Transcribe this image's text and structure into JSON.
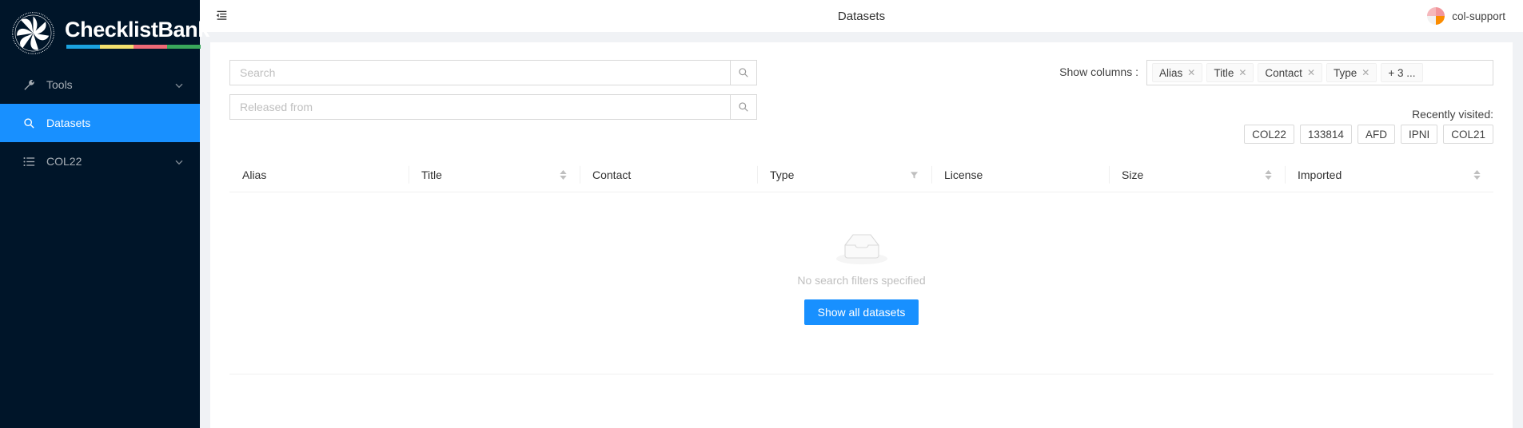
{
  "brand": {
    "title": "ChecklistBank",
    "logo_icon": "checklistbank-flower-logo",
    "bar_colors": [
      "#1ba3e0",
      "#f2e06e",
      "#ee6a76",
      "#39a85b"
    ]
  },
  "sidebar": {
    "background": "#001529",
    "active_color": "#1890ff",
    "items": [
      {
        "label": "Tools",
        "icon": "tool-icon",
        "active": false,
        "has_chevron": true
      },
      {
        "label": "Datasets",
        "icon": "search-icon",
        "active": true,
        "has_chevron": false
      },
      {
        "label": "COL22",
        "icon": "unordered-list-icon",
        "active": false,
        "has_chevron": true
      }
    ]
  },
  "topbar": {
    "fold_icon": "menu-fold-icon",
    "title": "Datasets",
    "user": {
      "name": "col-support",
      "avatar_icon": "user-avatar"
    }
  },
  "filters": {
    "search": {
      "placeholder": "Search",
      "value": "",
      "button_icon": "search-icon"
    },
    "released_from": {
      "placeholder": "Released from",
      "value": "",
      "button_icon": "search-icon"
    }
  },
  "show_columns": {
    "label": "Show columns :",
    "tags": [
      {
        "label": "Alias",
        "closable": true
      },
      {
        "label": "Title",
        "closable": true
      },
      {
        "label": "Contact",
        "closable": true
      },
      {
        "label": "Type",
        "closable": true
      },
      {
        "label": "+ 3 ...",
        "closable": false
      }
    ]
  },
  "recently_visited": {
    "label": "Recently visited:",
    "items": [
      "COL22",
      "133814",
      "AFD",
      "IPNI",
      "COL21"
    ]
  },
  "table": {
    "columns": [
      {
        "label": "Alias",
        "sortable": false,
        "filterable": false
      },
      {
        "label": "Title",
        "sortable": true,
        "filterable": false
      },
      {
        "label": "Contact",
        "sortable": false,
        "filterable": false
      },
      {
        "label": "Type",
        "sortable": false,
        "filterable": true
      },
      {
        "label": "License",
        "sortable": false,
        "filterable": false
      },
      {
        "label": "Size",
        "sortable": true,
        "filterable": false
      },
      {
        "label": "Imported",
        "sortable": true,
        "filterable": false
      }
    ],
    "rows": [],
    "empty": {
      "icon": "empty-inbox-icon",
      "text": "No search filters specified",
      "action_label": "Show all datasets",
      "action_color": "#1890ff"
    }
  }
}
